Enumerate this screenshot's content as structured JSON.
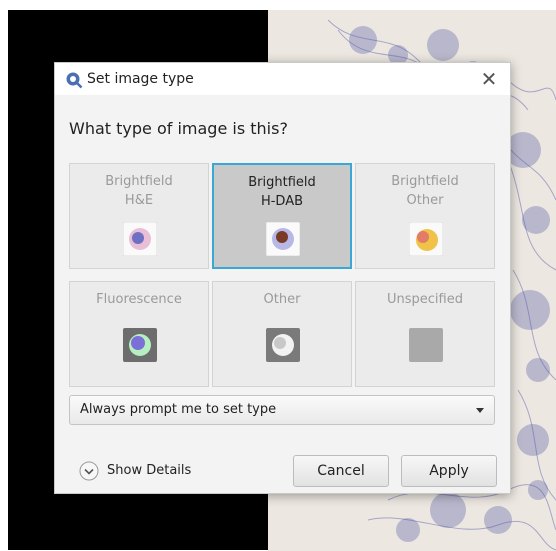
{
  "dialog": {
    "title": "Set image type",
    "close_label": "✕",
    "question": "What type of image is this?"
  },
  "image_types": [
    {
      "label": "Brightfield\nH&E",
      "icon": "he-stain-icon",
      "selected": false
    },
    {
      "label": "Brightfield\nH-DAB",
      "icon": "hdab-stain-icon",
      "selected": true
    },
    {
      "label": "Brightfield\nOther",
      "icon": "brightfield-other-icon",
      "selected": false
    },
    {
      "label": "Fluorescence",
      "icon": "fluorescence-icon",
      "selected": false
    },
    {
      "label": "Other",
      "icon": "other-type-icon",
      "selected": false
    },
    {
      "label": "Unspecified",
      "icon": "unspecified-icon",
      "selected": false
    }
  ],
  "prompt_select": {
    "value": "Always prompt me to set type"
  },
  "footer": {
    "show_details_label": "Show Details",
    "cancel_label": "Cancel",
    "apply_label": "Apply"
  },
  "colors": {
    "selection_border": "#3ba7d6",
    "tissue_stain": "#5a5fa8"
  }
}
